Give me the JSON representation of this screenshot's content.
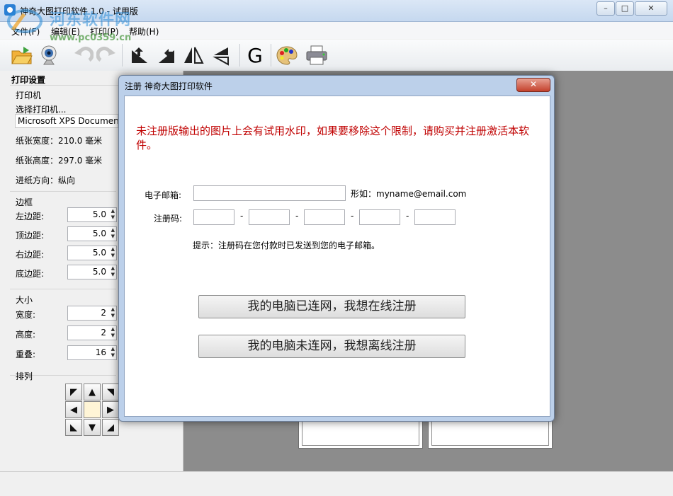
{
  "window": {
    "title": "神奇大图打印软件 1.0 - 试用版",
    "controls": [
      "–",
      "□",
      "✕"
    ]
  },
  "watermark": {
    "text": "河东软件网",
    "url": "www.pc0359.cn"
  },
  "menu": {
    "items": [
      "文件(F)",
      "编辑(E)",
      "打印(P)",
      "帮助(H)"
    ]
  },
  "toolbar": {
    "g_label": "G"
  },
  "left": {
    "header": "打印设置",
    "printer": {
      "group": "打印机",
      "choose": "选择打印机...",
      "name": "Microsoft XPS Document W",
      "paper_width": "纸张宽度：210.0 毫米",
      "paper_height": "纸张高度：297.0 毫米",
      "feed": "进纸方向：纵向"
    },
    "margins": {
      "group": "边框",
      "left_label": "左边距:",
      "left_value": "5.0",
      "top_label": "顶边距:",
      "top_value": "5.0",
      "right_label": "右边距:",
      "right_value": "5.0",
      "bottom_label": "底边距:",
      "bottom_value": "5.0"
    },
    "size": {
      "group": "大小",
      "width_label": "宽度:",
      "width_value": "2",
      "height_label": "高度:",
      "height_value": "2",
      "overlap_label": "重叠:",
      "overlap_value": "16"
    },
    "arrange": {
      "group": "排列"
    }
  },
  "dialog": {
    "title": "注册 神奇大图打印软件",
    "notice": "未注册版输出的图片上会有试用水印，如果要移除这个限制，请购买并注册激活本软件。",
    "email_label": "电子邮箱:",
    "email_value": "",
    "email_hint": "形如：myname@email.com",
    "code_label": "注册码:",
    "code_separator": "-",
    "tip": "提示：注册码在您付款时已发送到您的电子邮箱。",
    "online_button": "我的电脑已连网，我想在线注册",
    "offline_button": "我的电脑未连网，我想离线注册"
  }
}
